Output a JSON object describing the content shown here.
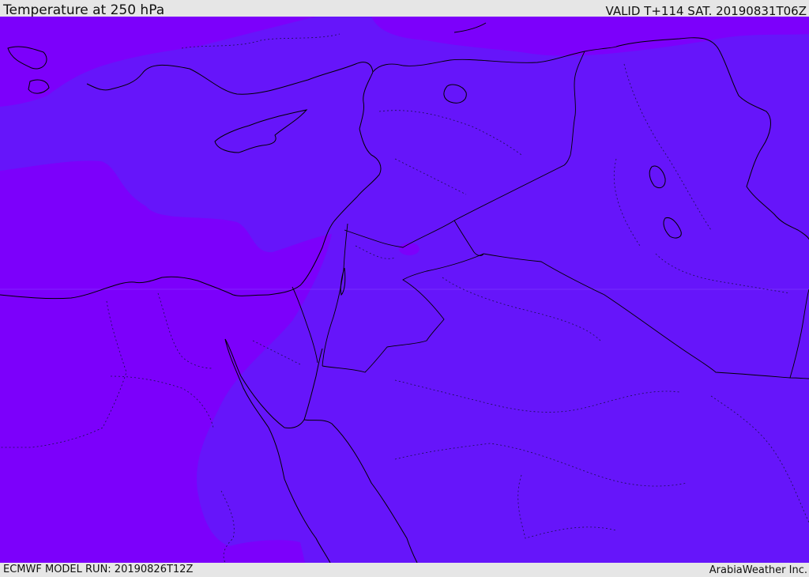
{
  "header": {
    "title": "Temperature at 250 hPa",
    "valid": "VALID T+114 SAT. 20190831T06Z"
  },
  "footer": {
    "model_run": "ECMWF MODEL RUN: 20190826T12Z",
    "credit": "ArabiaWeather Inc."
  },
  "map": {
    "colors": {
      "field_warm": "#6615fa",
      "field_cool": "#7c00fb",
      "coastline": "#000000",
      "border": "#000000",
      "internal_border": "#222244"
    }
  }
}
